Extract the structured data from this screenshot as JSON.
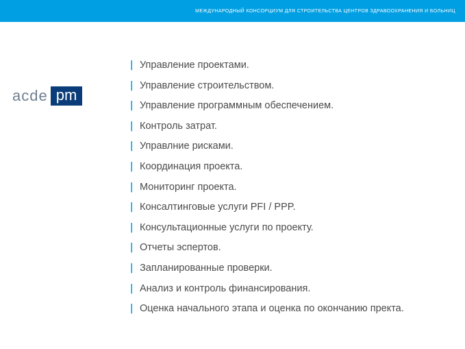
{
  "header": {
    "title": "МЕЖДУНАРОДНЫЙ КОНСОРЦИУМ ДЛЯ СТРОИТЕЛЬСТВА ЦЕНТРОВ ЗДРАВООХРАНЕНИЯ И БОЛЬНИЦ"
  },
  "logo": {
    "part1": "acde",
    "part2": "pm"
  },
  "list": {
    "items": [
      "Управление проектами.",
      "Управление строительством.",
      "Управление программным обеспечением.",
      "Контроль затрат.",
      "Управлние рисками.",
      "Координация проекта.",
      "Мониторинг проекта.",
      "Консалтинговые услуги PFI / PPP.",
      "Консультационные услуги по проекту.",
      "Отчеты эспертов.",
      "Запланированные проверки.",
      "Анализ и контроль финансирования.",
      "Оценка начального этапа и оценка по окончанию пректа."
    ]
  }
}
